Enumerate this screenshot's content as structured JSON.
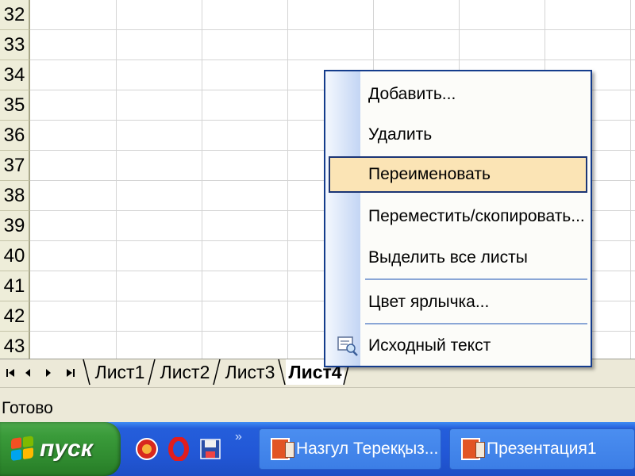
{
  "grid": {
    "row_numbers": [
      "32",
      "33",
      "34",
      "35",
      "36",
      "37",
      "38",
      "39",
      "40",
      "41",
      "42",
      "43"
    ]
  },
  "sheet_tabs": {
    "nav_icons": [
      "first-sheet-icon",
      "prev-sheet-icon",
      "next-sheet-icon",
      "last-sheet-icon"
    ],
    "tabs": [
      {
        "label": "Лист1",
        "active": false
      },
      {
        "label": "Лист2",
        "active": false
      },
      {
        "label": "Лист3",
        "active": false
      },
      {
        "label": "Лист4",
        "active": true
      }
    ]
  },
  "status_bar": {
    "text": "Готово"
  },
  "context_menu": {
    "items": [
      {
        "label": "Добавить...",
        "highlighted": false
      },
      {
        "label": "Удалить",
        "highlighted": false
      },
      {
        "label": "Переименовать",
        "highlighted": true
      },
      {
        "label": "Переместить/скопировать...",
        "highlighted": false
      },
      {
        "label": "Выделить все листы",
        "highlighted": false
      },
      {
        "label": "Цвет ярлычка...",
        "highlighted": false
      },
      {
        "label": "Исходный текст",
        "highlighted": false,
        "icon": "view-code-icon"
      }
    ]
  },
  "taskbar": {
    "start_label": "пуск",
    "quick_launch_icons": [
      "opera-icon",
      "opera-red-icon",
      "save-icon"
    ],
    "quick_launch_more": "»",
    "tasks": [
      {
        "label": "Назгул Терекқыз...",
        "icon": "powerpoint-icon"
      },
      {
        "label": "Презентация1",
        "icon": "powerpoint-icon"
      }
    ]
  },
  "colors": {
    "selection_highlight": "#fbe4b5",
    "menu_border": "#143c8c",
    "taskbar_blue": "#245edb",
    "start_green": "#3a9b3a"
  }
}
